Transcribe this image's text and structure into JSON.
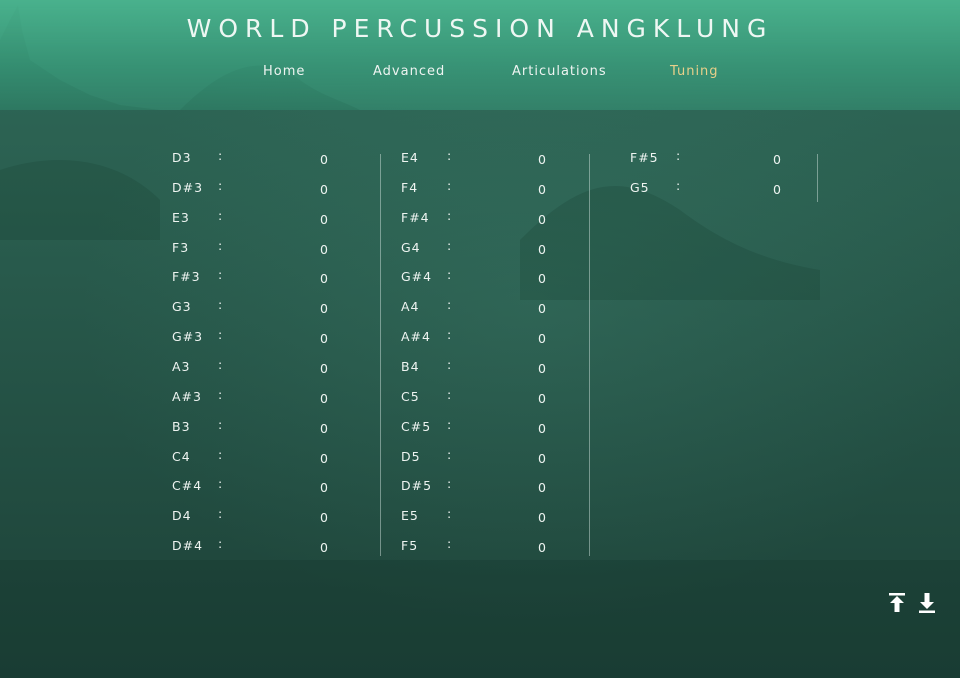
{
  "app": {
    "title": "WORLD PERCUSSION ANGKLUNG"
  },
  "nav": {
    "items": [
      {
        "label": "Home",
        "active": false
      },
      {
        "label": "Advanced",
        "active": false
      },
      {
        "label": "Articulations",
        "active": false
      },
      {
        "label": "Tuning",
        "active": true
      }
    ]
  },
  "tuning": {
    "separator": ":",
    "columns": [
      [
        {
          "note": "D3",
          "value": "0"
        },
        {
          "note": "D#3",
          "value": "0"
        },
        {
          "note": "E3",
          "value": "0"
        },
        {
          "note": "F3",
          "value": "0"
        },
        {
          "note": "F#3",
          "value": "0"
        },
        {
          "note": "G3",
          "value": "0"
        },
        {
          "note": "G#3",
          "value": "0"
        },
        {
          "note": "A3",
          "value": "0"
        },
        {
          "note": "A#3",
          "value": "0"
        },
        {
          "note": "B3",
          "value": "0"
        },
        {
          "note": "C4",
          "value": "0"
        },
        {
          "note": "C#4",
          "value": "0"
        },
        {
          "note": "D4",
          "value": "0"
        },
        {
          "note": "D#4",
          "value": "0"
        }
      ],
      [
        {
          "note": "E4",
          "value": "0"
        },
        {
          "note": "F4",
          "value": "0"
        },
        {
          "note": "F#4",
          "value": "0"
        },
        {
          "note": "G4",
          "value": "0"
        },
        {
          "note": "G#4",
          "value": "0"
        },
        {
          "note": "A4",
          "value": "0"
        },
        {
          "note": "A#4",
          "value": "0"
        },
        {
          "note": "B4",
          "value": "0"
        },
        {
          "note": "C5",
          "value": "0"
        },
        {
          "note": "C#5",
          "value": "0"
        },
        {
          "note": "D5",
          "value": "0"
        },
        {
          "note": "D#5",
          "value": "0"
        },
        {
          "note": "E5",
          "value": "0"
        },
        {
          "note": "F5",
          "value": "0"
        }
      ],
      [
        {
          "note": "F#5",
          "value": "0"
        },
        {
          "note": "G5",
          "value": "0"
        }
      ]
    ]
  },
  "icons": {
    "upload": "upload-icon",
    "download": "download-icon"
  },
  "colors": {
    "header": "#4fbf96",
    "active_tab": "#e8d08a",
    "text": "#eef4f1",
    "background": "#234f43"
  }
}
